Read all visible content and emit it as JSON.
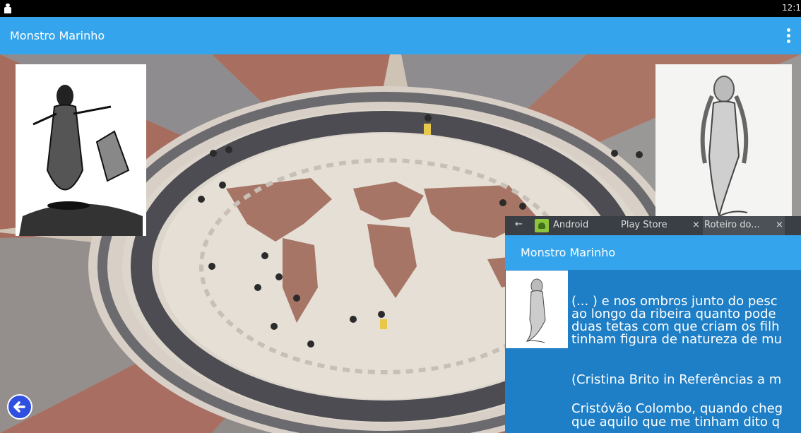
{
  "status_bar": {
    "time": "12:1"
  },
  "app_bar": {
    "title": "Monstro Marinho"
  },
  "browser": {
    "tabs": [
      {
        "label": "Android"
      },
      {
        "label": "Play Store"
      },
      {
        "label": "Roteiro do..."
      }
    ],
    "inner_title": "Monstro Marinho",
    "paragraph_lines": [
      "(... ) e nos ombros junto do pesc",
      "ao longo da ribeira quanto pode",
      "duas tetas com que criam os filh",
      "tinham figura de natureza de mu"
    ],
    "citation": "(Cristina Brito in Referências a m",
    "paragraph2_lines": [
      "Cristóvão Colombo, quando cheg",
      "que aquilo que me tinham dito q"
    ]
  },
  "colors": {
    "app_bar": "#34a4ec",
    "browser_body": "#1e7ec6",
    "tab_bar": "#3a3f45",
    "back_button": "#2f4fe0"
  },
  "icons": {
    "overflow": "vertical-dots-icon",
    "back": "arrow-left-icon",
    "tab_back": "arrow-left-icon",
    "android": "android-icon",
    "close": "close-icon"
  }
}
